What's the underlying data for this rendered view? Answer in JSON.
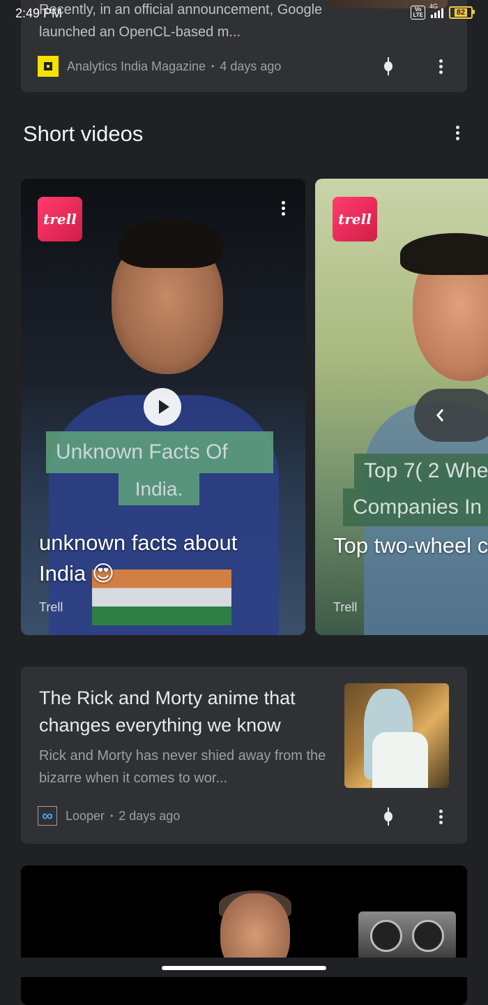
{
  "status_bar": {
    "time": "2:49 PM",
    "volte": "Vo LTE",
    "network": "4G",
    "battery": "82"
  },
  "article_top": {
    "snippet": "Recently, in an official announcement, Google launched an OpenCL-based m...",
    "source": "Analytics India Magazine",
    "age": "4 days ago"
  },
  "section": {
    "title": "Short videos"
  },
  "videos": [
    {
      "logo": "trell",
      "overlay": [
        "Unknown Facts Of",
        "India."
      ],
      "title": "unknown facts about India 😍",
      "source": "Trell"
    },
    {
      "logo": "trell",
      "overlay": [
        "Top 7( 2 Whe",
        "Companies In"
      ],
      "title": "Top two-wheel companies in In",
      "source": "Trell"
    }
  ],
  "article_rick": {
    "headline": "The Rick and Morty anime that changes everything we know",
    "snippet": "Rick and Morty has never shied away from the bizarre when it comes to wor...",
    "source": "Looper",
    "age": "2 days ago"
  },
  "colors": {
    "background": "#202124",
    "card": "#303134",
    "trell_brand": "#e8264f",
    "aim_brand": "#f4e100"
  },
  "icons": [
    "play-icon",
    "more-vert-icon",
    "chevron-left-icon",
    "pin-icon"
  ]
}
